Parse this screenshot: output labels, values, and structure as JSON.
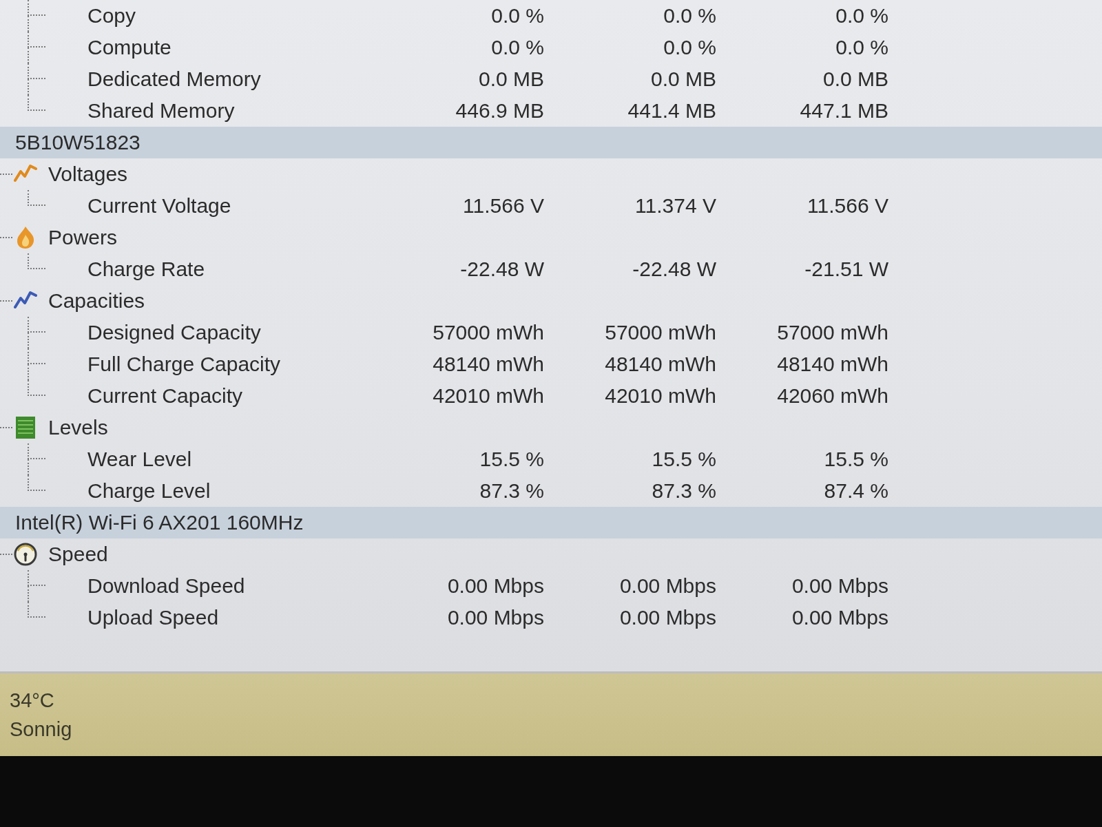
{
  "sensor_tree": {
    "continued_sensors": [
      {
        "label": "Copy",
        "values": [
          "0.0 %",
          "0.0 %",
          "0.0 %"
        ]
      },
      {
        "label": "Compute",
        "values": [
          "0.0 %",
          "0.0 %",
          "0.0 %"
        ]
      },
      {
        "label": "Dedicated Memory",
        "values": [
          "0.0 MB",
          "0.0 MB",
          "0.0 MB"
        ]
      },
      {
        "label": "Shared Memory",
        "values": [
          "446.9 MB",
          "441.4 MB",
          "447.1 MB"
        ]
      }
    ],
    "devices": [
      {
        "name": "5B10W51823",
        "children": [
          {
            "name": "Voltages",
            "kind": "voltage",
            "children": [
              {
                "label": "Current Voltage",
                "values": [
                  "11.566 V",
                  "11.374 V",
                  "11.566 V"
                ]
              }
            ]
          },
          {
            "name": "Powers",
            "kind": "power",
            "children": [
              {
                "label": "Charge Rate",
                "values": [
                  "-22.48 W",
                  "-22.48 W",
                  "-21.51 W"
                ]
              }
            ]
          },
          {
            "name": "Capacities",
            "kind": "capacity",
            "children": [
              {
                "label": "Designed Capacity",
                "values": [
                  "57000 mWh",
                  "57000 mWh",
                  "57000 mWh"
                ]
              },
              {
                "label": "Full Charge Capacity",
                "values": [
                  "48140 mWh",
                  "48140 mWh",
                  "48140 mWh"
                ]
              },
              {
                "label": "Current Capacity",
                "values": [
                  "42010 mWh",
                  "42010 mWh",
                  "42060 mWh"
                ]
              }
            ]
          },
          {
            "name": "Levels",
            "kind": "level",
            "children": [
              {
                "label": "Wear Level",
                "values": [
                  "15.5 %",
                  "15.5 %",
                  "15.5 %"
                ]
              },
              {
                "label": "Charge Level",
                "values": [
                  "87.3 %",
                  "87.3 %",
                  "87.4 %"
                ]
              }
            ]
          }
        ]
      },
      {
        "name": "Intel(R) Wi-Fi 6 AX201 160MHz",
        "children": [
          {
            "name": "Speed",
            "kind": "speed",
            "children": [
              {
                "label": "Download Speed",
                "values": [
                  "0.00 Mbps",
                  "0.00 Mbps",
                  "0.00 Mbps"
                ]
              },
              {
                "label": "Upload Speed",
                "values": [
                  "0.00 Mbps",
                  "0.00 Mbps",
                  "0.00 Mbps"
                ]
              }
            ]
          }
        ]
      }
    ]
  },
  "taskbar": {
    "weather": {
      "temperature": "34°C",
      "condition": "Sonnig"
    }
  }
}
